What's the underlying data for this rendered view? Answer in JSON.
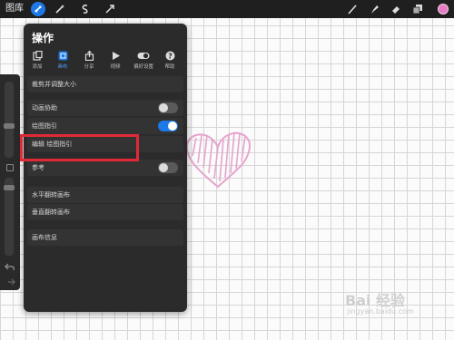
{
  "topbar": {
    "gallery_label": "图库",
    "tools": [
      "wrench-icon",
      "magic-wand-icon",
      "selection-icon",
      "transform-icon"
    ],
    "right_tools": [
      "brush-icon",
      "smudge-icon",
      "eraser-icon",
      "layers-icon"
    ],
    "color": "#e57cc3"
  },
  "panel": {
    "title": "操作",
    "tabs": [
      {
        "label": "添加"
      },
      {
        "label": "画布"
      },
      {
        "label": "分享"
      },
      {
        "label": "视频"
      },
      {
        "label": "偏好设置"
      },
      {
        "label": "帮助"
      }
    ],
    "items": {
      "crop": "裁剪并调整大小",
      "animation": "动画协助",
      "drawing_guide": "绘图指引",
      "edit_guide": "编辑 绘图指引",
      "reference": "参考",
      "flip_h": "水平翻转画布",
      "flip_v": "垂直翻转画布",
      "canvas_info": "画布信息"
    },
    "toggles": {
      "animation": false,
      "drawing_guide": true,
      "reference": false
    }
  },
  "watermark": {
    "logo": "Bai 经验",
    "url": "jingyan.baidu.com"
  },
  "accent": "#1e78e6",
  "highlight_color": "#e22937"
}
